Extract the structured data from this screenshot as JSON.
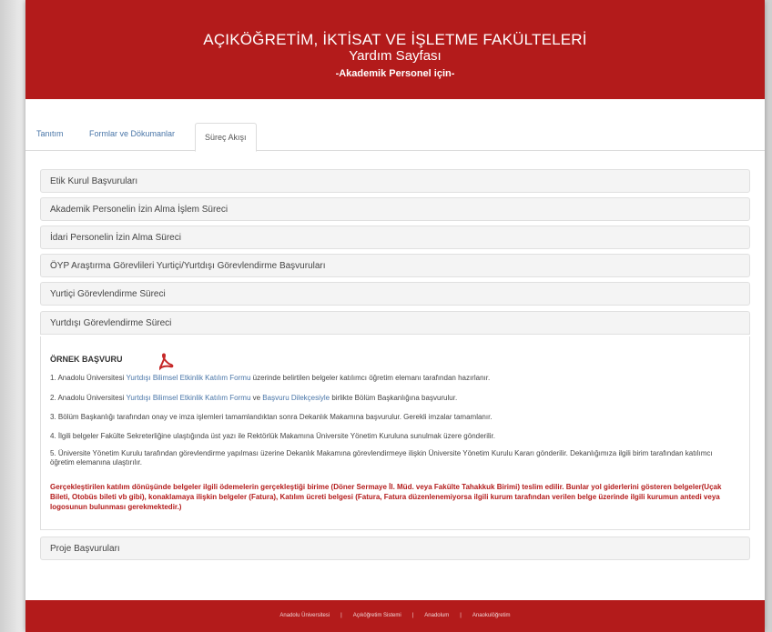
{
  "header": {
    "title": "AÇIKÖĞRETİM, İKTİSAT VE İŞLETME FAKÜLTELERİ",
    "subtitle": "Yardım Sayfası",
    "audience": "-Akademik Personel için-"
  },
  "tabs": [
    {
      "label": "Tanıtım"
    },
    {
      "label": "Formlar ve Dökumanlar"
    },
    {
      "label": "Süreç Akışı"
    }
  ],
  "accordion": [
    {
      "label": "Etik Kurul Başvuruları"
    },
    {
      "label": "Akademik Personelin İzin Alma İşlem Süreci"
    },
    {
      "label": "İdari Personelin İzin Alma Süreci"
    },
    {
      "label": "ÖYP Araştırma Görevlileri Yurtiçi/Yurtdışı Görevlendirme Başvuruları"
    },
    {
      "label": "Yurtiçi Görevlendirme Süreci"
    },
    {
      "label": "Yurtdışı Görevlendirme Süreci"
    },
    {
      "label": "Proje Başvuruları"
    }
  ],
  "panel": {
    "example_title": "ÖRNEK BAŞVURU",
    "steps": [
      {
        "a": "1. Anadolu Üniversitesi ",
        "link": "Yurtdışı Bilimsel Etkinlik Katılım Formu",
        "b": " üzerinde belirtilen belgeler katılımcı öğretim elemanı tarafından hazırlanır."
      },
      {
        "a": "2. Anadolu Üniversitesi ",
        "link": "Yurtdışı Bilimsel Etkinlik Katılım Formu",
        "mid": " ve ",
        "link2": "Başvuru Dilekçesiyle",
        "b": " birlikte Bölüm Başkanlığına başvurulur."
      },
      {
        "a": "3. Bölüm Başkanlığı tarafından onay ve imza işlemleri tamamlandıktan sonra Dekanlık Makamına başvurulur. Gerekli imzalar tamamlanır."
      },
      {
        "a": "4. İlgili belgeler Fakülte Sekreterliğine ulaştığında üst yazı ile Rektörlük Makamına Üniversite Yönetim Kuruluna sunulmak üzere gönderilir."
      },
      {
        "a": "5. Üniversite Yönetim Kurulu tarafından görevlendirme yapılması üzerine Dekanlık Makamına görevlendirmeye ilişkin Üniversite Yönetim Kurulu Kararı gönderilir. Dekanlığımıza ilgili birim tarafından katılımcı öğretim elemanına ulaştırılır."
      }
    ],
    "note": "Gerçekleştirilen katılım dönüşünde belgeler ilgili ödemelerin gerçekleştiği birime (Döner Sermaye İl. Müd. veya Fakülte Tahakkuk Birimi) teslim edilir. Bunlar yol giderlerini gösteren belgeler(Uçak Bileti, Otobüs bileti vb gibi), konaklamaya ilişkin belgeler (Fatura), Katılım ücreti belgesi (Fatura, Fatura düzenlenemiyorsa ilgili kurum tarafından verilen belge üzerinde ilgili kurumun antedi veya logosunun bulunması gerekmektedir.)"
  },
  "footer": {
    "links": [
      "Anadolu Üniversitesi",
      "Açıköğretim Sistemi",
      "Anadolum",
      "Anaokulöğretim"
    ],
    "separator": "|"
  },
  "colors": {
    "brand": "#b31b1b",
    "link": "#4a76a8"
  },
  "icons": {
    "pdf": "pdf-icon"
  }
}
